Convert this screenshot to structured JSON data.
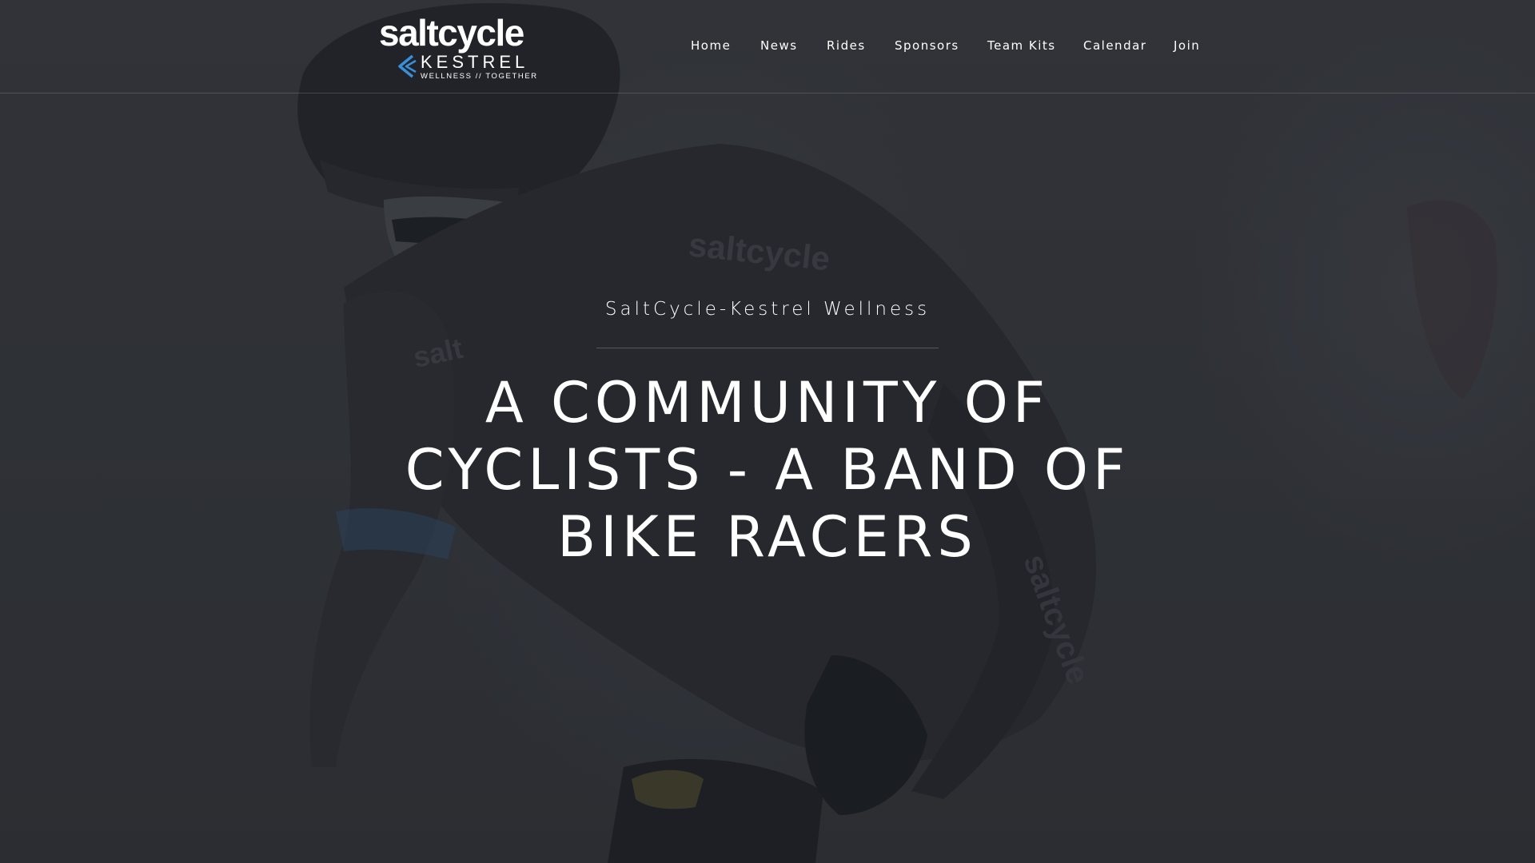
{
  "brand": {
    "logo_main": "saltcycle",
    "logo_secondary": "KESTREL",
    "logo_tagline": "WELLNESS // TOGETHER",
    "accent_color": "#3a8fd8"
  },
  "nav": {
    "items": [
      {
        "label": "Home"
      },
      {
        "label": "News"
      },
      {
        "label": "Rides"
      },
      {
        "label": "Sponsors"
      },
      {
        "label": "Team Kits"
      },
      {
        "label": "Calendar"
      },
      {
        "label": "Join"
      }
    ]
  },
  "hero": {
    "subtitle": "SaltCycle-Kestrel Wellness",
    "headline": "A COMMUNITY OF CYCLISTS - A BAND OF BIKE RACERS",
    "background_image": "cyclist-photo"
  }
}
